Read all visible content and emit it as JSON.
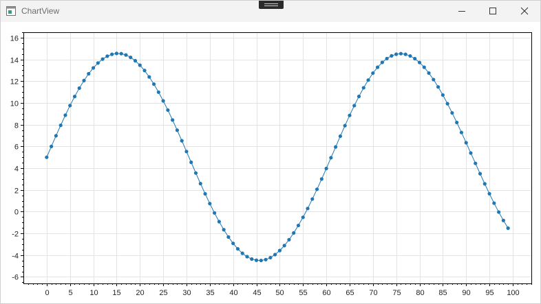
{
  "window": {
    "title": "ChartView",
    "app_icon": "app-window-icon",
    "controls": {
      "minimize_icon": "minimize-icon",
      "maximize_icon": "maximize-icon",
      "close_icon": "close-icon"
    }
  },
  "chart_data": {
    "type": "line",
    "title": "",
    "xlabel": "",
    "ylabel": "",
    "xlim": [
      -5,
      104
    ],
    "ylim": [
      -6.6,
      16.5
    ],
    "xticks": [
      0,
      5,
      10,
      15,
      20,
      25,
      30,
      35,
      40,
      45,
      50,
      55,
      60,
      65,
      70,
      75,
      80,
      85,
      90,
      95,
      100
    ],
    "yticks": [
      -6,
      -4,
      -2,
      0,
      2,
      4,
      6,
      8,
      10,
      12,
      14,
      16
    ],
    "grid": true,
    "legend": "none",
    "markers": true,
    "series_color": "#1f77b4",
    "grid_color": "#e3e3e3",
    "series": [
      {
        "x": [
          0,
          1,
          2,
          3,
          4,
          5,
          6,
          7,
          8,
          9,
          10,
          11,
          12,
          13,
          14,
          15,
          16,
          17,
          18,
          19,
          20,
          21,
          22,
          23,
          24,
          25,
          26,
          27,
          28,
          29,
          30,
          31,
          32,
          33,
          34,
          35,
          36,
          37,
          38,
          39,
          40,
          41,
          42,
          43,
          44,
          45,
          46,
          47,
          48,
          49,
          50,
          51,
          52,
          53,
          54,
          55,
          56,
          57,
          58,
          59,
          60,
          61,
          62,
          63,
          64,
          65,
          66,
          67,
          68,
          69,
          70,
          71,
          72,
          73,
          74,
          75,
          76,
          77,
          78,
          79,
          80,
          81,
          82,
          83,
          84,
          85,
          86,
          87,
          88,
          89,
          90,
          91,
          92,
          93,
          94,
          95,
          96,
          97,
          98,
          99
        ],
        "y": [
          5.0,
          6.0,
          6.98,
          7.94,
          8.87,
          9.76,
          10.59,
          11.36,
          12.06,
          12.68,
          13.22,
          13.67,
          14.03,
          14.3,
          14.47,
          14.55,
          14.53,
          14.41,
          14.19,
          13.88,
          13.47,
          12.98,
          12.39,
          11.73,
          10.99,
          10.19,
          9.34,
          8.43,
          7.49,
          6.52,
          5.53,
          4.54,
          3.55,
          2.58,
          1.64,
          0.74,
          -0.12,
          -0.92,
          -1.66,
          -2.33,
          -2.92,
          -3.42,
          -3.83,
          -4.14,
          -4.36,
          -4.47,
          -4.49,
          -4.41,
          -4.23,
          -3.95,
          -3.58,
          -3.12,
          -2.58,
          -1.96,
          -1.27,
          -0.52,
          0.29,
          1.16,
          2.06,
          3.0,
          3.97,
          4.96,
          5.95,
          6.94,
          7.91,
          8.85,
          9.75,
          10.6,
          11.39,
          12.1,
          12.74,
          13.28,
          13.73,
          14.08,
          14.33,
          14.48,
          14.53,
          14.47,
          14.32,
          14.07,
          13.72,
          13.28,
          12.75,
          12.15,
          11.47,
          10.73,
          9.93,
          9.08,
          8.2,
          7.28,
          6.34,
          5.39,
          4.44,
          3.49,
          2.56,
          1.65,
          0.78,
          -0.04,
          -0.81,
          -1.52
        ]
      }
    ]
  }
}
